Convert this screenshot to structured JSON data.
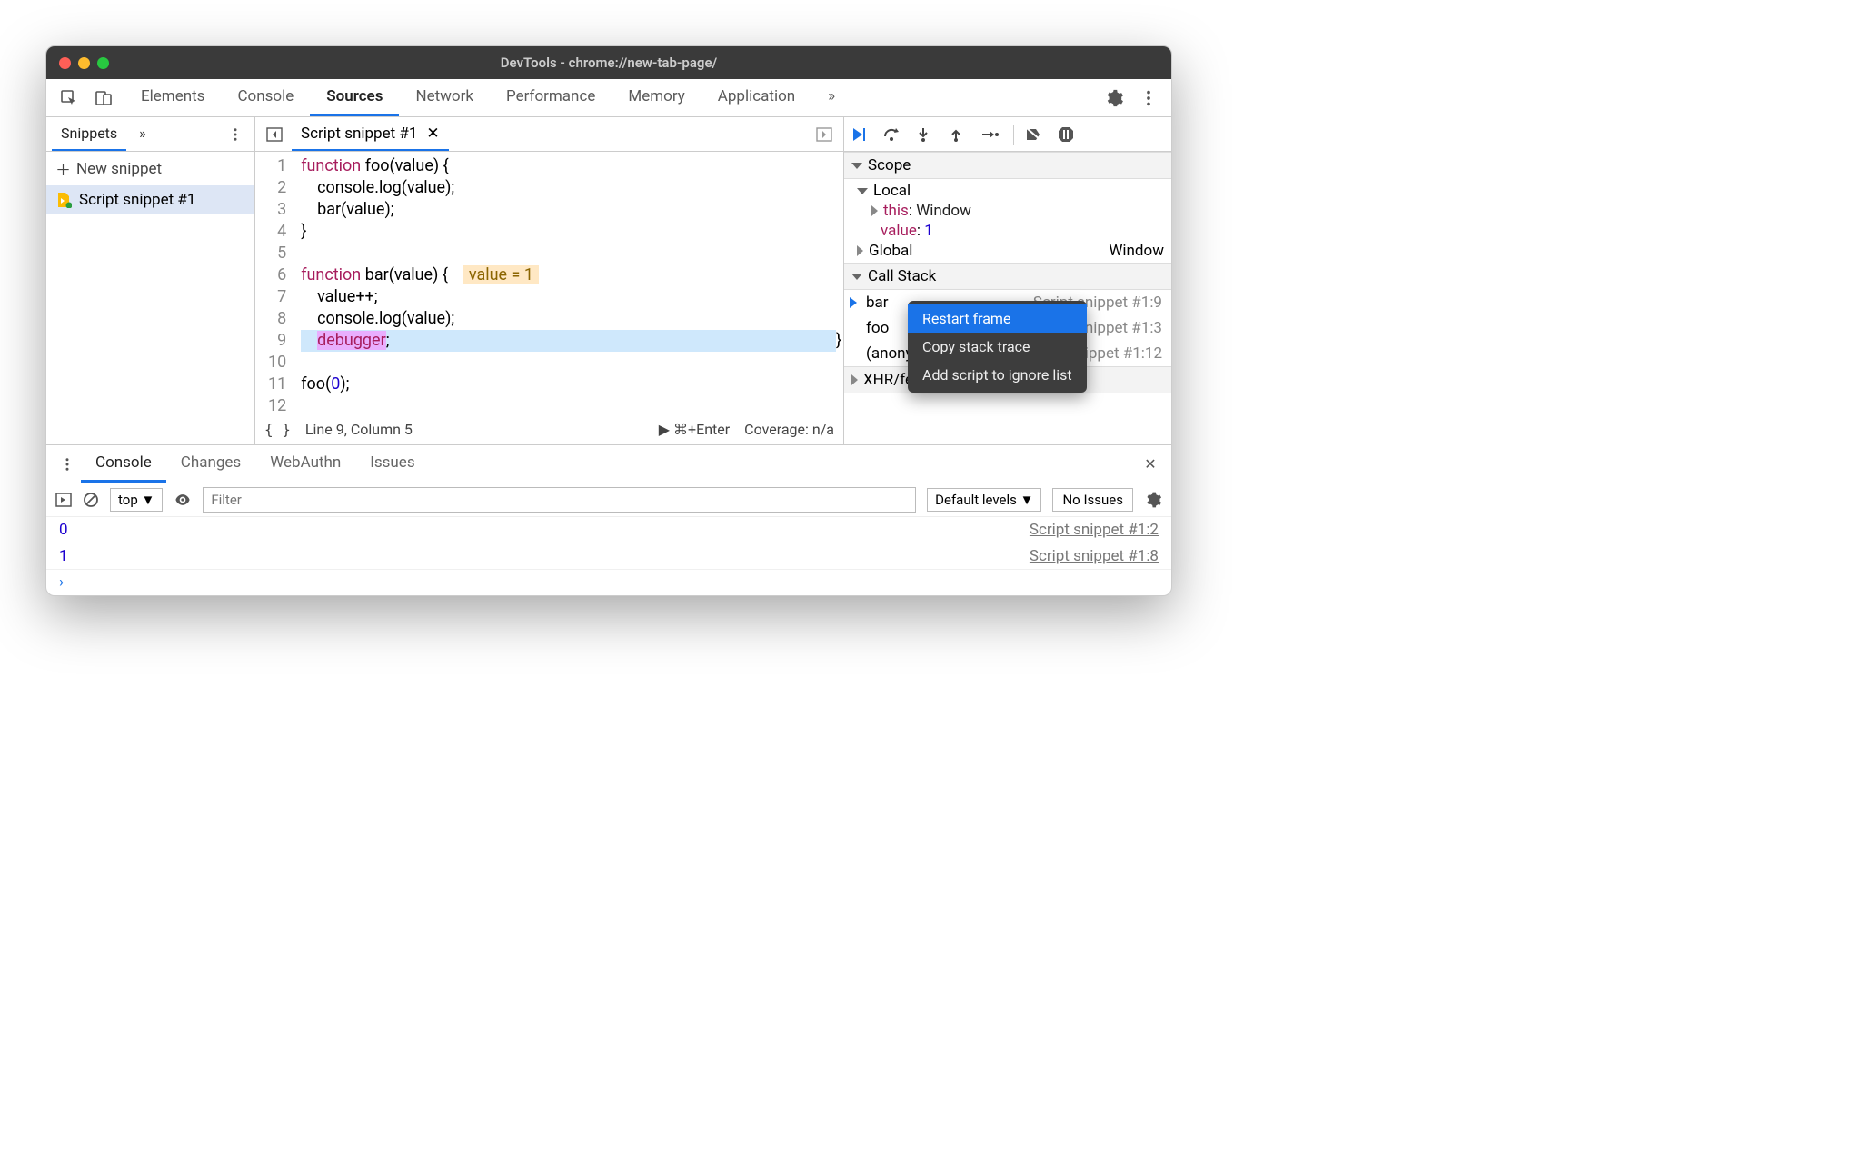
{
  "window": {
    "title": "DevTools - chrome://new-tab-page/"
  },
  "toolbar_tabs": [
    "Elements",
    "Console",
    "Sources",
    "Network",
    "Performance",
    "Memory",
    "Application"
  ],
  "toolbar_active": "Sources",
  "sidebar": {
    "active_tab": "Snippets",
    "new_label": "New snippet",
    "items": [
      {
        "label": "Script snippet #1"
      }
    ]
  },
  "editor": {
    "open_tab": "Script snippet #1",
    "lines": [
      "function foo(value) {",
      "    console.log(value);",
      "    bar(value);",
      "}",
      "",
      "function bar(value) {",
      "    value++;",
      "    console.log(value);",
      "    debugger;",
      "}",
      "",
      "foo(0);",
      ""
    ],
    "inline_badge": {
      "line": 6,
      "text": "value = 1"
    },
    "highlight_line": 9,
    "status": {
      "cursor": "Line 9, Column 5",
      "run_hint": "⌘+Enter",
      "coverage": "Coverage: n/a"
    }
  },
  "debug": {
    "sections": {
      "scope": "Scope",
      "local": "Local",
      "this_label": "this",
      "this_value": "Window",
      "value_label": "value",
      "value_value": "1",
      "global": "Global",
      "global_value": "Window",
      "callstack": "Call Stack",
      "xhr": "XHR/fetch Breakpoints"
    },
    "callstack": [
      {
        "fn": "bar",
        "loc": "Script snippet #1:9",
        "current": true
      },
      {
        "fn": "foo",
        "loc": "Script snippet #1:3",
        "current": false
      },
      {
        "fn": "(anonymous)",
        "loc": "Script snippet #1:12",
        "current": false
      }
    ],
    "context_menu": {
      "items": [
        "Restart frame",
        "Copy stack trace",
        "Add script to ignore list"
      ],
      "selected": 0
    }
  },
  "drawer": {
    "tabs": [
      "Console",
      "Changes",
      "WebAuthn",
      "Issues"
    ],
    "active": "Console",
    "context": "top",
    "filter_placeholder": "Filter",
    "levels": "Default levels",
    "issues": "No Issues",
    "logs": [
      {
        "value": "0",
        "src": "Script snippet #1:2"
      },
      {
        "value": "1",
        "src": "Script snippet #1:8"
      }
    ]
  }
}
